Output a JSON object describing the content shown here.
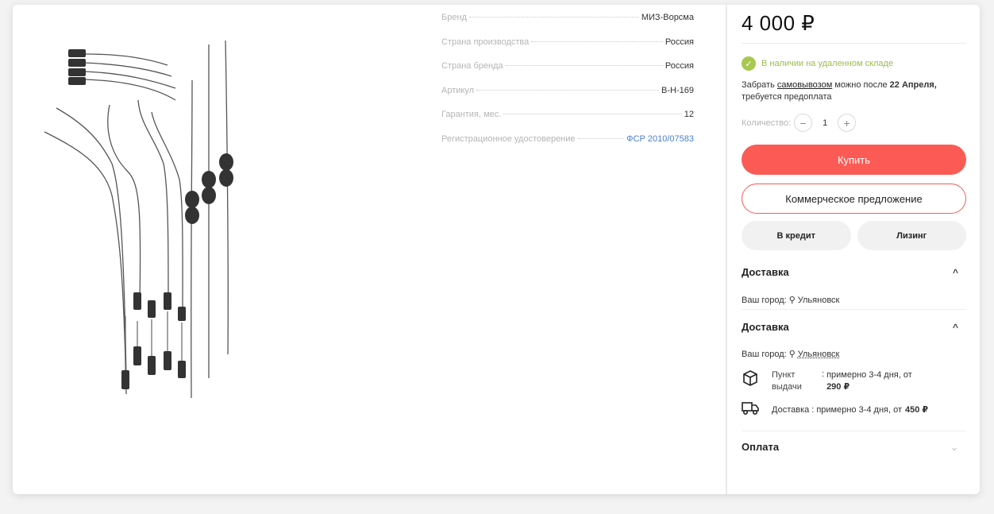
{
  "specs": [
    {
      "key": "Бренд",
      "value": "МИЗ-Ворсма",
      "link": false
    },
    {
      "key": "Страна производства",
      "value": "Россия",
      "link": false
    },
    {
      "key": "Страна бренда",
      "value": "Россия",
      "link": false
    },
    {
      "key": "Артикул",
      "value": "В-Н-169",
      "link": false
    },
    {
      "key": "Гарантия, мес.",
      "value": "12",
      "link": false
    },
    {
      "key": "Регистрационное удостоверение",
      "value": "ФСР 2010/07583",
      "link": true
    }
  ],
  "price": "4 000 ₽",
  "stock": "В наличии на удаленном складе",
  "pickup": {
    "prefix": "Забрать",
    "link": "самовывозом",
    "middle": "можно после",
    "date": "22 Апреля,",
    "note": "требуется предоплата"
  },
  "quantity": {
    "label": "Количество:",
    "value": "1",
    "minus": "−",
    "plus": "+"
  },
  "buttons": {
    "buy": "Купить",
    "offer": "Коммерческое предложение",
    "credit": "В кредит",
    "leasing": "Лизинг"
  },
  "delivery_collapsed": {
    "title": "Доставка",
    "city_label": "Ваш город:",
    "city": "Ульяновск"
  },
  "delivery": {
    "title": "Доставка",
    "city_label": "Ваш город:",
    "city": "Ульяновск",
    "pickup_point": {
      "label": "Пункт выдачи",
      "sep": ":",
      "info": "примерно 3-4 дня, от",
      "price": "290 ₽"
    },
    "courier": {
      "label": "Доставка",
      "sep": ":",
      "info": "примерно 3-4 дня, от",
      "price": "450 ₽"
    }
  },
  "payment": {
    "title": "Оплата"
  },
  "icons": {
    "check": "check-icon",
    "pin": "location-pin-icon",
    "box": "box-icon",
    "truck": "truck-icon",
    "chevron_up": "chevron-up-icon",
    "chevron_down": "chevron-down-icon"
  },
  "colors": {
    "accent": "#fc5b55",
    "stock": "#a9c84f",
    "link": "#4a7fd0"
  }
}
